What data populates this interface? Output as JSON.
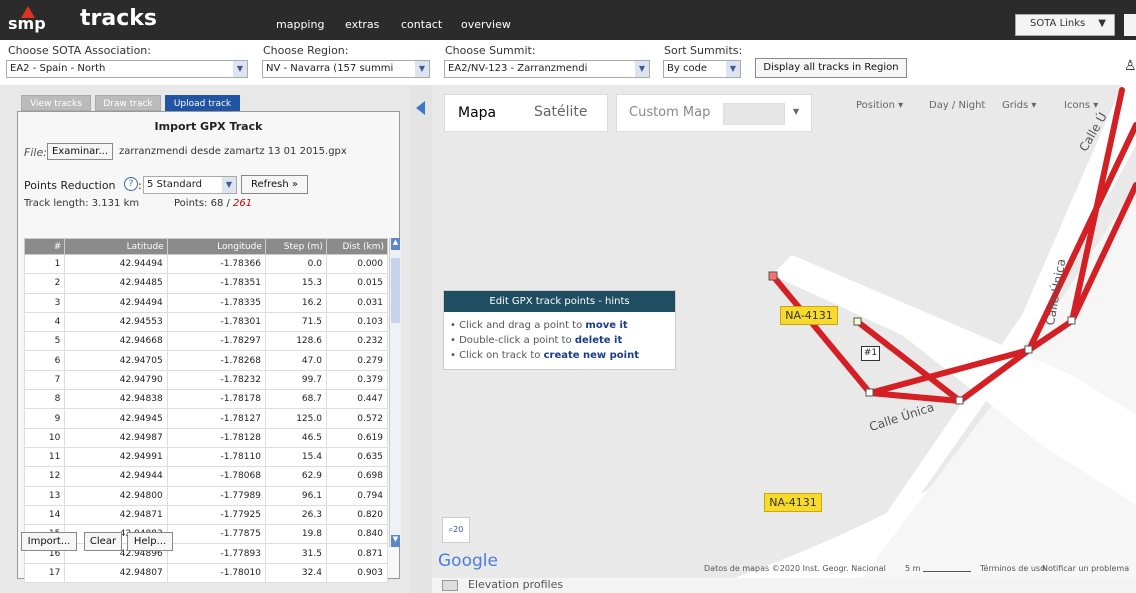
{
  "brand": {
    "logo_text": "smp",
    "title": "tracks"
  },
  "nav": [
    "mapping",
    "extras",
    "contact",
    "overview"
  ],
  "top_right": {
    "sota_links": "SOTA Links",
    "caret": "▼"
  },
  "selectors": {
    "association": {
      "label": "Choose SOTA Association:",
      "value": "EA2 - Spain - North"
    },
    "region": {
      "label": "Choose Region:",
      "value": "NV - Navarra      (157 summi"
    },
    "summit": {
      "label": "Choose Summit:",
      "value": "EA2/NV-123 - Zarranzmendi"
    },
    "sort": {
      "label": "Sort Summits:",
      "value": "By code"
    },
    "display_button": "Display all tracks in Region"
  },
  "tabs": [
    "View tracks",
    "Draw track",
    "Upload track"
  ],
  "import": {
    "heading": "Import GPX Track",
    "file_label": "File:",
    "browse_button": "Examinar...",
    "file_name": "zarranzmendi desde zamartz 13 01 2015.gpx",
    "points_reduction_label": "Points Reduction",
    "help_glyph": "?",
    "reduction_value": "5  Standard",
    "refresh_button": "Refresh »",
    "track_length": "Track length: 3.131 km",
    "points_label": "Points: 68 /",
    "points_total": "261"
  },
  "table": {
    "headers": [
      "#",
      "Latitude",
      "Longitude",
      "Step (m)",
      "Dist (km)"
    ],
    "rows": [
      [
        "1",
        "42.94494",
        "-1.78366",
        "0.0",
        "0.000"
      ],
      [
        "2",
        "42.94485",
        "-1.78351",
        "15.3",
        "0.015"
      ],
      [
        "3",
        "42.94494",
        "-1.78335",
        "16.2",
        "0.031"
      ],
      [
        "4",
        "42.94553",
        "-1.78301",
        "71.5",
        "0.103"
      ],
      [
        "5",
        "42.94668",
        "-1.78297",
        "128.6",
        "0.232"
      ],
      [
        "6",
        "42.94705",
        "-1.78268",
        "47.0",
        "0.279"
      ],
      [
        "7",
        "42.94790",
        "-1.78232",
        "99.7",
        "0.379"
      ],
      [
        "8",
        "42.94838",
        "-1.78178",
        "68.7",
        "0.447"
      ],
      [
        "9",
        "42.94945",
        "-1.78127",
        "125.0",
        "0.572"
      ],
      [
        "10",
        "42.94987",
        "-1.78128",
        "46.5",
        "0.619"
      ],
      [
        "11",
        "42.94991",
        "-1.78110",
        "15.4",
        "0.635"
      ],
      [
        "12",
        "42.94944",
        "-1.78068",
        "62.9",
        "0.698"
      ],
      [
        "13",
        "42.94800",
        "-1.77989",
        "96.1",
        "0.794"
      ],
      [
        "14",
        "42.94871",
        "-1.77925",
        "26.3",
        "0.820"
      ],
      [
        "15",
        "42.94883",
        "-1.77875",
        "19.8",
        "0.840"
      ],
      [
        "16",
        "42.94896",
        "-1.77893",
        "31.5",
        "0.871"
      ],
      [
        "17",
        "42.94807",
        "-1.78010",
        "32.4",
        "0.903"
      ]
    ]
  },
  "footer_buttons": [
    "Import...",
    "Clear",
    "Help..."
  ],
  "map": {
    "types": [
      "Mapa",
      "Satélite",
      "Custom Map"
    ],
    "controls": [
      "Position ▾",
      "Day / Night",
      "Grids ▾",
      "Icons ▾"
    ],
    "hint_title": "Edit GPX track points - hints",
    "hints": [
      {
        "pre": "Click and drag a point to ",
        "action": "move it"
      },
      {
        "pre": "Double-click a point to ",
        "action": "delete it"
      },
      {
        "pre": "Click on track to ",
        "action": "create new point"
      }
    ],
    "road_labels": [
      "NA-4131",
      "NA-4131"
    ],
    "street_labels": [
      "Calle Única",
      "Calle Única",
      "Calle Ú"
    ],
    "point_label": "#1",
    "google": "Google",
    "attribution": "Datos de mapas ©2020 Inst. Geogr. Nacional",
    "scale": "5 m",
    "terms": "Términos de uso",
    "report": "Notificar un problema",
    "elevation": "Elevation profiles"
  }
}
